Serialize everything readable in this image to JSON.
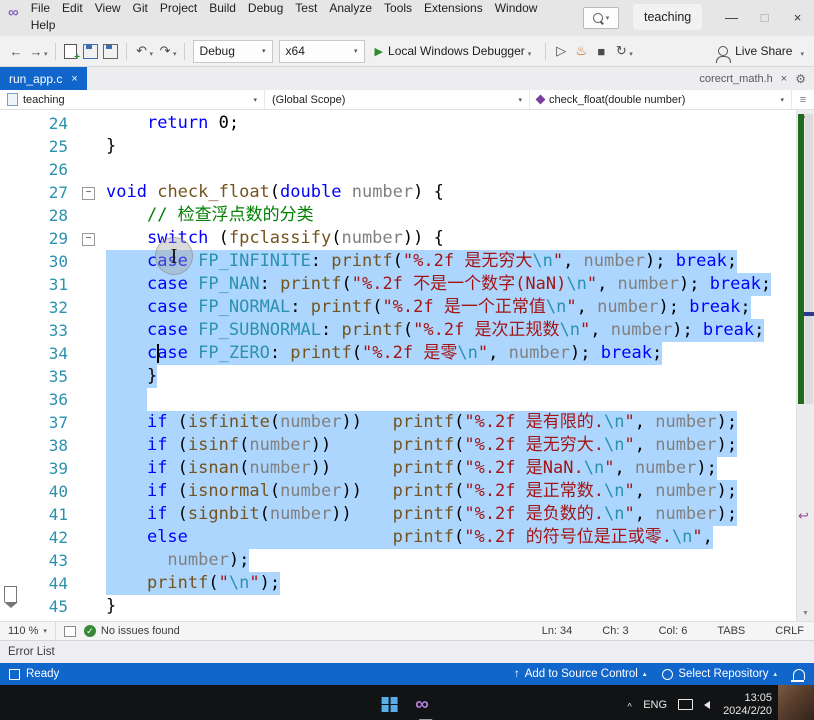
{
  "accent": "#1166cb",
  "selection_color": "#add6ff",
  "icons": {
    "back": "←",
    "forward": "→",
    "undo": "↶",
    "redo": "↷",
    "caret_down": "▾",
    "caret_up": "▴",
    "play": "▶",
    "play_hollow": "▷",
    "minimize": "—",
    "maximize": "□",
    "close": "×",
    "fold_collapse": "−",
    "check": "✓",
    "up_arrow": "↑",
    "gear": "⚙",
    "return_hint": "↩",
    "ibeam": "I",
    "chevron_up": "˄",
    "flame": "♨",
    "stop": "■",
    "restart": "↻",
    "scroll_up": "▲",
    "scroll_down": "▼",
    "overflow": "▾",
    "plus": "≡"
  },
  "title_bar": {
    "menu_rows": [
      [
        "File",
        "Edit",
        "View",
        "Git",
        "Project",
        "Build",
        "Debug",
        "Test",
        "Analyze",
        "Tools",
        "Extensions",
        "Window"
      ],
      [
        "Help"
      ]
    ],
    "window_title": "teaching"
  },
  "toolbar": {
    "configuration": "Debug",
    "platform": "x64",
    "start_button": "Local Windows Debugger",
    "live_share": "Live Share"
  },
  "tab_bar": {
    "active_tab": "run_app.c",
    "secondary_tab": "corecrt_math.h"
  },
  "navigation_bar": {
    "project": "teaching",
    "scope": "(Global Scope)",
    "member": "check_float(double number)"
  },
  "editor": {
    "caret": {
      "line": 34,
      "col": 6
    },
    "lines": [
      {
        "n": 24,
        "sel": false,
        "seg": [
          [
            "    ",
            "pl"
          ],
          [
            "return",
            "kw"
          ],
          [
            " 0;",
            "pl"
          ]
        ]
      },
      {
        "n": 25,
        "sel": false,
        "seg": [
          [
            "}",
            "pl"
          ]
        ]
      },
      {
        "n": 26,
        "sel": false,
        "seg": []
      },
      {
        "n": 27,
        "sel": false,
        "fold": true,
        "seg": [
          [
            "void",
            "kw"
          ],
          [
            " ",
            "pl"
          ],
          [
            "check_float",
            "fn"
          ],
          [
            "(",
            "pl"
          ],
          [
            "double",
            "kw"
          ],
          [
            " ",
            "pl"
          ],
          [
            "number",
            "id"
          ],
          [
            ") {",
            "pl"
          ]
        ]
      },
      {
        "n": 28,
        "sel": false,
        "seg": [
          [
            "    ",
            "pl"
          ],
          [
            "// 检查浮点数的分类",
            "cm"
          ]
        ]
      },
      {
        "n": 29,
        "sel": false,
        "fold": true,
        "seg": [
          [
            "    ",
            "pl"
          ],
          [
            "switch",
            "kw"
          ],
          [
            " (",
            "pl"
          ],
          [
            "fpclassify",
            "fn"
          ],
          [
            "(",
            "pl"
          ],
          [
            "number",
            "id"
          ],
          [
            ")) {",
            "pl"
          ]
        ]
      },
      {
        "n": 30,
        "sel": true,
        "seg": [
          [
            "    ",
            "pl"
          ],
          [
            "case",
            "kw"
          ],
          [
            " ",
            "pl"
          ],
          [
            "FP_INFINITE",
            "mac"
          ],
          [
            ": ",
            "pl"
          ],
          [
            "printf",
            "fn"
          ],
          [
            "(",
            "pl"
          ],
          [
            "\"%.2f 是无穷大",
            "str"
          ],
          [
            "\\n",
            "esc"
          ],
          [
            "\"",
            "str"
          ],
          [
            ", ",
            "pl"
          ],
          [
            "number",
            "id"
          ],
          [
            "); ",
            "pl"
          ],
          [
            "break",
            "kw"
          ],
          [
            ";",
            "pl"
          ]
        ]
      },
      {
        "n": 31,
        "sel": true,
        "seg": [
          [
            "    ",
            "pl"
          ],
          [
            "case",
            "kw"
          ],
          [
            " ",
            "pl"
          ],
          [
            "FP_NAN",
            "mac"
          ],
          [
            ": ",
            "pl"
          ],
          [
            "printf",
            "fn"
          ],
          [
            "(",
            "pl"
          ],
          [
            "\"%.2f 不是一个数字(NaN)",
            "str"
          ],
          [
            "\\n",
            "esc"
          ],
          [
            "\"",
            "str"
          ],
          [
            ", ",
            "pl"
          ],
          [
            "number",
            "id"
          ],
          [
            "); ",
            "pl"
          ],
          [
            "break",
            "kw"
          ],
          [
            ";",
            "pl"
          ]
        ]
      },
      {
        "n": 32,
        "sel": true,
        "seg": [
          [
            "    ",
            "pl"
          ],
          [
            "case",
            "kw"
          ],
          [
            " ",
            "pl"
          ],
          [
            "FP_NORMAL",
            "mac"
          ],
          [
            ": ",
            "pl"
          ],
          [
            "printf",
            "fn"
          ],
          [
            "(",
            "pl"
          ],
          [
            "\"%.2f 是一个正常值",
            "str"
          ],
          [
            "\\n",
            "esc"
          ],
          [
            "\"",
            "str"
          ],
          [
            ", ",
            "pl"
          ],
          [
            "number",
            "id"
          ],
          [
            "); ",
            "pl"
          ],
          [
            "break",
            "kw"
          ],
          [
            ";",
            "pl"
          ]
        ]
      },
      {
        "n": 33,
        "sel": true,
        "seg": [
          [
            "    ",
            "pl"
          ],
          [
            "case",
            "kw"
          ],
          [
            " ",
            "pl"
          ],
          [
            "FP_SUBNORMAL",
            "mac"
          ],
          [
            ": ",
            "pl"
          ],
          [
            "printf",
            "fn"
          ],
          [
            "(",
            "pl"
          ],
          [
            "\"%.2f 是次正规数",
            "str"
          ],
          [
            "\\n",
            "esc"
          ],
          [
            "\"",
            "str"
          ],
          [
            ", ",
            "pl"
          ],
          [
            "number",
            "id"
          ],
          [
            "); ",
            "pl"
          ],
          [
            "break",
            "kw"
          ],
          [
            ";",
            "pl"
          ]
        ]
      },
      {
        "n": 34,
        "sel": true,
        "seg": [
          [
            "    ",
            "pl"
          ],
          [
            "case",
            "kw"
          ],
          [
            " ",
            "pl"
          ],
          [
            "FP_ZERO",
            "mac"
          ],
          [
            ": ",
            "pl"
          ],
          [
            "printf",
            "fn"
          ],
          [
            "(",
            "pl"
          ],
          [
            "\"%.2f 是零",
            "str"
          ],
          [
            "\\n",
            "esc"
          ],
          [
            "\"",
            "str"
          ],
          [
            ", ",
            "pl"
          ],
          [
            "number",
            "id"
          ],
          [
            "); ",
            "pl"
          ],
          [
            "break",
            "kw"
          ],
          [
            ";",
            "pl"
          ]
        ]
      },
      {
        "n": 35,
        "sel": true,
        "seg": [
          [
            "    }",
            "pl"
          ]
        ]
      },
      {
        "n": 36,
        "sel": true,
        "seg": []
      },
      {
        "n": 37,
        "sel": true,
        "seg": [
          [
            "    ",
            "pl"
          ],
          [
            "if",
            "kw"
          ],
          [
            " (",
            "pl"
          ],
          [
            "isfinite",
            "fn"
          ],
          [
            "(",
            "pl"
          ],
          [
            "number",
            "id"
          ],
          [
            "))   ",
            "pl"
          ],
          [
            "printf",
            "fn"
          ],
          [
            "(",
            "pl"
          ],
          [
            "\"%.2f 是有限的.",
            "str"
          ],
          [
            "\\n",
            "esc"
          ],
          [
            "\"",
            "str"
          ],
          [
            ", ",
            "pl"
          ],
          [
            "number",
            "id"
          ],
          [
            ");",
            "pl"
          ]
        ]
      },
      {
        "n": 38,
        "sel": true,
        "seg": [
          [
            "    ",
            "pl"
          ],
          [
            "if",
            "kw"
          ],
          [
            " (",
            "pl"
          ],
          [
            "isinf",
            "fn"
          ],
          [
            "(",
            "pl"
          ],
          [
            "number",
            "id"
          ],
          [
            "))      ",
            "pl"
          ],
          [
            "printf",
            "fn"
          ],
          [
            "(",
            "pl"
          ],
          [
            "\"%.2f 是无穷大.",
            "str"
          ],
          [
            "\\n",
            "esc"
          ],
          [
            "\"",
            "str"
          ],
          [
            ", ",
            "pl"
          ],
          [
            "number",
            "id"
          ],
          [
            ");",
            "pl"
          ]
        ]
      },
      {
        "n": 39,
        "sel": true,
        "seg": [
          [
            "    ",
            "pl"
          ],
          [
            "if",
            "kw"
          ],
          [
            " (",
            "pl"
          ],
          [
            "isnan",
            "fn"
          ],
          [
            "(",
            "pl"
          ],
          [
            "number",
            "id"
          ],
          [
            "))      ",
            "pl"
          ],
          [
            "printf",
            "fn"
          ],
          [
            "(",
            "pl"
          ],
          [
            "\"%.2f 是NaN.",
            "str"
          ],
          [
            "\\n",
            "esc"
          ],
          [
            "\"",
            "str"
          ],
          [
            ", ",
            "pl"
          ],
          [
            "number",
            "id"
          ],
          [
            ");",
            "pl"
          ]
        ]
      },
      {
        "n": 40,
        "sel": true,
        "seg": [
          [
            "    ",
            "pl"
          ],
          [
            "if",
            "kw"
          ],
          [
            " (",
            "pl"
          ],
          [
            "isnormal",
            "fn"
          ],
          [
            "(",
            "pl"
          ],
          [
            "number",
            "id"
          ],
          [
            "))   ",
            "pl"
          ],
          [
            "printf",
            "fn"
          ],
          [
            "(",
            "pl"
          ],
          [
            "\"%.2f 是正常数.",
            "str"
          ],
          [
            "\\n",
            "esc"
          ],
          [
            "\"",
            "str"
          ],
          [
            ", ",
            "pl"
          ],
          [
            "number",
            "id"
          ],
          [
            ");",
            "pl"
          ]
        ]
      },
      {
        "n": 41,
        "sel": true,
        "seg": [
          [
            "    ",
            "pl"
          ],
          [
            "if",
            "kw"
          ],
          [
            " (",
            "pl"
          ],
          [
            "signbit",
            "fn"
          ],
          [
            "(",
            "pl"
          ],
          [
            "number",
            "id"
          ],
          [
            "))    ",
            "pl"
          ],
          [
            "printf",
            "fn"
          ],
          [
            "(",
            "pl"
          ],
          [
            "\"%.2f 是负数的.",
            "str"
          ],
          [
            "\\n",
            "esc"
          ],
          [
            "\"",
            "str"
          ],
          [
            ", ",
            "pl"
          ],
          [
            "number",
            "id"
          ],
          [
            ");",
            "pl"
          ]
        ]
      },
      {
        "n": 42,
        "sel": true,
        "seg": [
          [
            "    ",
            "pl"
          ],
          [
            "else",
            "kw"
          ],
          [
            "                    ",
            "pl"
          ],
          [
            "printf",
            "fn"
          ],
          [
            "(",
            "pl"
          ],
          [
            "\"%.2f 的符号位是正或零.",
            "str"
          ],
          [
            "\\n",
            "esc"
          ],
          [
            "\"",
            "str"
          ],
          [
            ",",
            "pl"
          ]
        ]
      },
      {
        "n": 43,
        "sel": true,
        "seg": [
          [
            "      ",
            "pl"
          ],
          [
            "number",
            "id"
          ],
          [
            ");",
            "pl"
          ]
        ]
      },
      {
        "n": 44,
        "sel": true,
        "seg": [
          [
            "    ",
            "pl"
          ],
          [
            "printf",
            "fn"
          ],
          [
            "(",
            "pl"
          ],
          [
            "\"",
            "str"
          ],
          [
            "\\n",
            "esc"
          ],
          [
            "\"",
            "str"
          ],
          [
            ");",
            "pl"
          ]
        ]
      },
      {
        "n": 45,
        "sel": false,
        "seg": [
          [
            "}",
            "pl"
          ]
        ]
      }
    ]
  },
  "editor_status": {
    "zoom": "110 %",
    "health": "No issues found",
    "ln": "Ln: 34",
    "ch": "Ch: 3",
    "col": "Col: 6",
    "tabs": "TABS",
    "eol": "CRLF"
  },
  "error_list": {
    "title": "Error List"
  },
  "status_bar": {
    "ready": "Ready",
    "add_source_control": "Add to Source Control",
    "select_repository": "Select Repository"
  },
  "taskbar": {
    "language": "ENG",
    "time": "13:05",
    "date": "2024/2/20"
  }
}
